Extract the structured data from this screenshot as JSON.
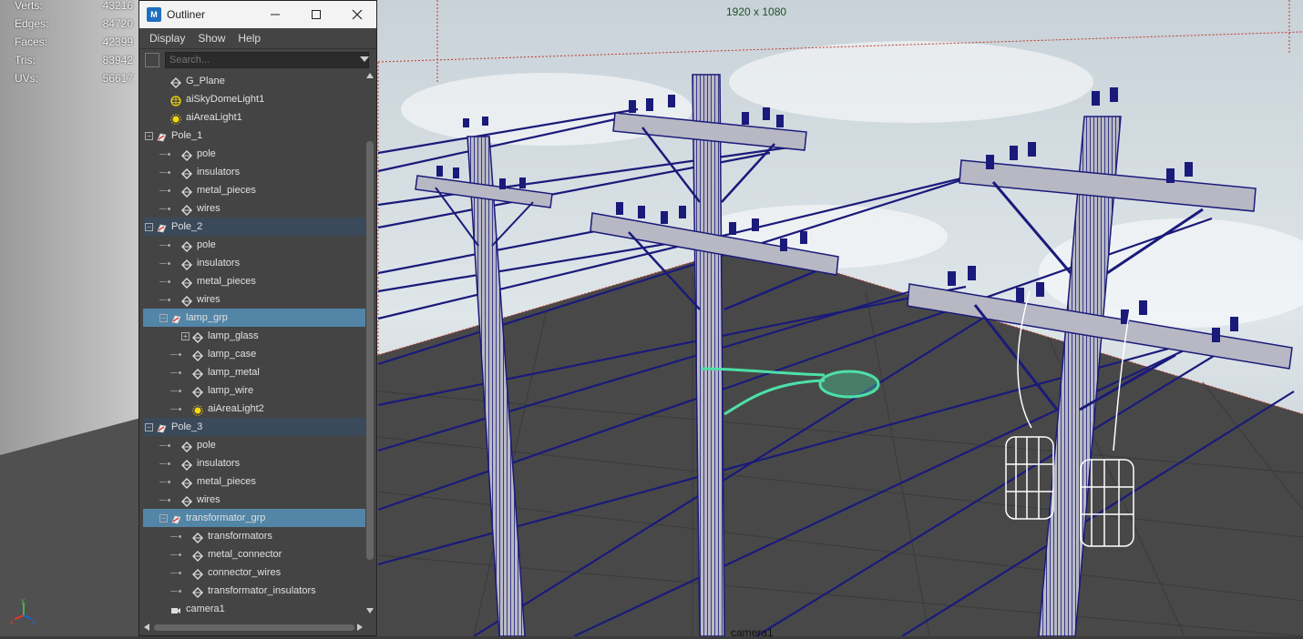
{
  "hud": {
    "stats": [
      {
        "label": "Verts:",
        "value": "43216"
      },
      {
        "label": "Edges:",
        "value": "84720"
      },
      {
        "label": "Faces:",
        "value": "42399"
      },
      {
        "label": "Tris:",
        "value": "83942"
      },
      {
        "label": "UVs:",
        "value": "56617"
      }
    ]
  },
  "viewport": {
    "resolution": "1920 x 1080",
    "camera": "camera1"
  },
  "outliner": {
    "title": "Outliner",
    "app_icon": "M",
    "menus": [
      "Display",
      "Show",
      "Help"
    ],
    "search_placeholder": "Search...",
    "items": [
      {
        "label": "G_Plane",
        "icon": "mesh-icon",
        "level": 1
      },
      {
        "label": "aiSkyDomeLight1",
        "icon": "skydome-light-icon",
        "level": 1
      },
      {
        "label": "aiAreaLight1",
        "icon": "area-light-icon",
        "level": 1
      },
      {
        "label": "Pole_1",
        "icon": "group-icon",
        "level": 0,
        "expander": "−"
      },
      {
        "label": "pole",
        "icon": "mesh-icon",
        "level": 2
      },
      {
        "label": "insulators",
        "icon": "mesh-icon",
        "level": 2
      },
      {
        "label": "metal_pieces",
        "icon": "mesh-icon",
        "level": 2
      },
      {
        "label": "wires",
        "icon": "mesh-icon",
        "level": 2
      },
      {
        "label": "Pole_2",
        "icon": "group-icon",
        "level": 0,
        "expander": "−",
        "state": "hl"
      },
      {
        "label": "pole",
        "icon": "mesh-icon",
        "level": 2
      },
      {
        "label": "insulators",
        "icon": "mesh-icon",
        "level": 2
      },
      {
        "label": "metal_pieces",
        "icon": "mesh-icon",
        "level": 2
      },
      {
        "label": "wires",
        "icon": "mesh-icon",
        "level": 2
      },
      {
        "label": "lamp_grp",
        "icon": "group-icon",
        "level": 1,
        "expander": "−",
        "state": "sel"
      },
      {
        "label": "lamp_glass",
        "icon": "mesh-icon",
        "level": 3,
        "expander": "+"
      },
      {
        "label": "lamp_case",
        "icon": "mesh-icon",
        "level": 3
      },
      {
        "label": "lamp_metal",
        "icon": "mesh-icon",
        "level": 3
      },
      {
        "label": "lamp_wire",
        "icon": "mesh-icon",
        "level": 3
      },
      {
        "label": "aiAreaLight2",
        "icon": "area-light-icon",
        "level": 3
      },
      {
        "label": "Pole_3",
        "icon": "group-icon",
        "level": 0,
        "expander": "−",
        "state": "hl"
      },
      {
        "label": "pole",
        "icon": "mesh-icon",
        "level": 2
      },
      {
        "label": "insulators",
        "icon": "mesh-icon",
        "level": 2
      },
      {
        "label": "metal_pieces",
        "icon": "mesh-icon",
        "level": 2
      },
      {
        "label": "wires",
        "icon": "mesh-icon",
        "level": 2
      },
      {
        "label": "transformator_grp",
        "icon": "group-icon",
        "level": 1,
        "expander": "−",
        "state": "sel"
      },
      {
        "label": "transformators",
        "icon": "mesh-icon",
        "level": 3
      },
      {
        "label": "metal_connector",
        "icon": "mesh-icon",
        "level": 3
      },
      {
        "label": "connector_wires",
        "icon": "mesh-icon",
        "level": 3
      },
      {
        "label": "transformator_insulators",
        "icon": "mesh-icon",
        "level": 3
      },
      {
        "label": "camera1",
        "icon": "camera-icon",
        "level": 1
      }
    ]
  },
  "colors": {
    "wire": "#1a1a7a",
    "pole_fill": "#b4b4bc",
    "selected_row": "#5285a6",
    "lamp_highlight": "#4de0a8",
    "transformer": "#ffffff"
  }
}
